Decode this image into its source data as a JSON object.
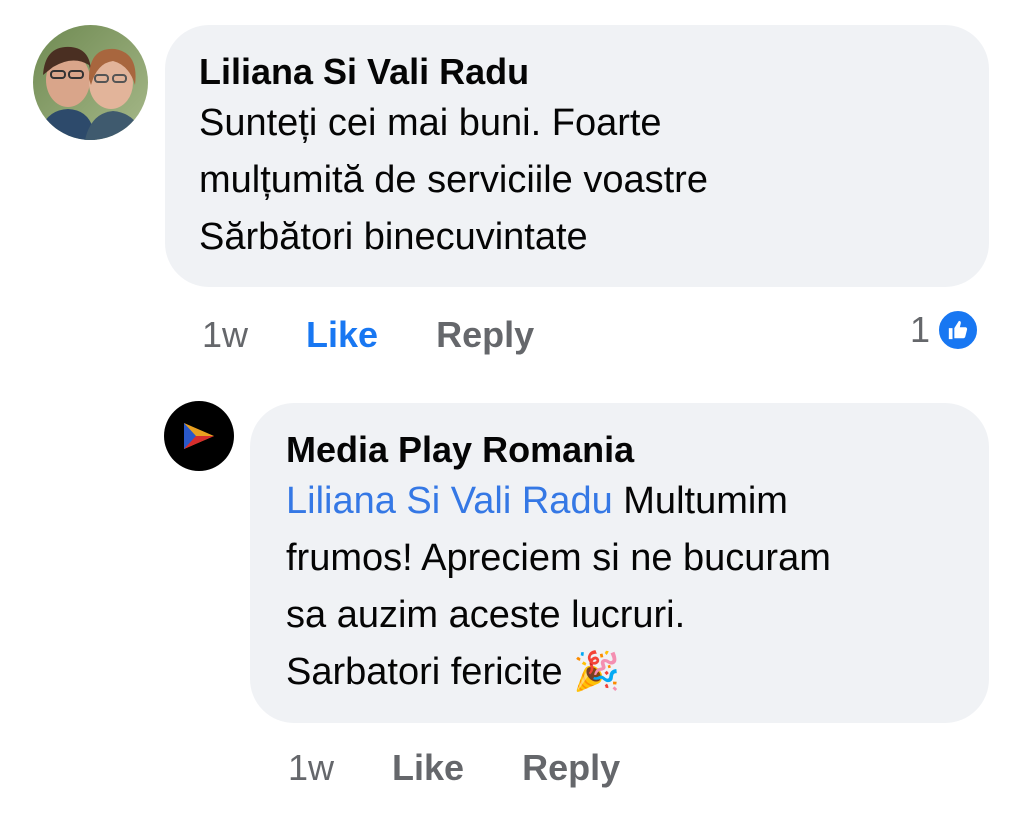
{
  "comment1": {
    "author": "Liliana Si Vali Radu",
    "text": "Sunteți cei mai buni.  Foarte\nmulțumită de serviciile voastre\nSărbători binecuvintate",
    "time": "1w",
    "like_label": "Like",
    "reply_label": "Reply",
    "reaction_count": "1",
    "reaction_icon": "thumbs-up-icon",
    "like_color": "#1877f2"
  },
  "comment2": {
    "author": "Media Play Romania",
    "mention": "Liliana Si Vali Radu",
    "text_after_mention": " Multumim\nfrumos! Apreciem si ne bucuram\nsa auzim aceste lucruri.\nSarbatori fericite ",
    "emoji": "🎉",
    "time": "1w",
    "like_label": "Like",
    "reply_label": "Reply",
    "avatar_icon": "play-logo-icon"
  },
  "colors": {
    "bubble": "#f0f2f5",
    "mention": "#3578e5",
    "meta": "#65676b"
  }
}
